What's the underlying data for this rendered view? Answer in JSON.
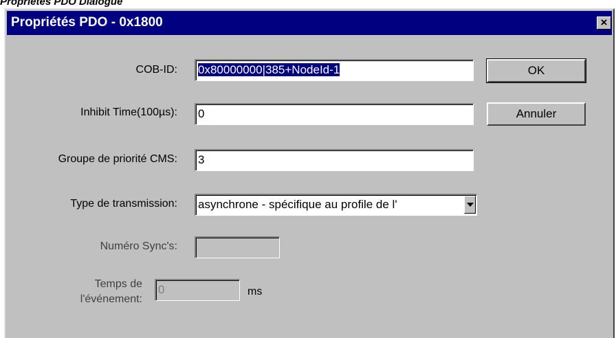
{
  "caption": "Propriétés PDO Dialogue",
  "dialog": {
    "title": "Propriétés PDO - 0x1800",
    "close_glyph": "×"
  },
  "fields": {
    "cob_id": {
      "label": "COB-ID:",
      "value": "0x80000000|385+NodeId-1"
    },
    "inhibit_time": {
      "label": "Inhibit Time(100µs):",
      "value": "0"
    },
    "priority_group": {
      "label": "Groupe de priorité CMS:",
      "value": "3"
    },
    "transmission_type": {
      "label": "Type de transmission:",
      "value": "asynchrone - spécifique au profile de l'"
    },
    "sync_number": {
      "label": "Numéro Sync's:",
      "value": ""
    },
    "event_time": {
      "label_line1": "Temps de",
      "label_line2": "l'événement:",
      "value": "0",
      "unit": "ms"
    }
  },
  "buttons": {
    "ok": "OK",
    "cancel": "Annuler"
  }
}
